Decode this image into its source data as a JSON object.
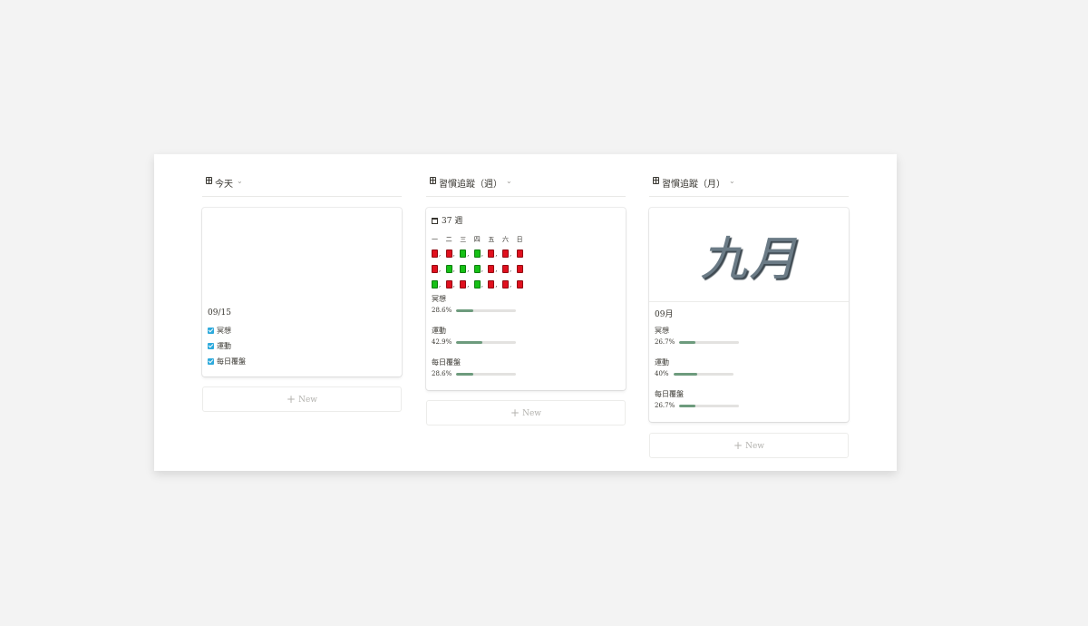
{
  "columns": [
    {
      "header": "今天",
      "card": {
        "date": "09/15",
        "checklist": [
          "冥想",
          "運動",
          "每日覆盤"
        ]
      },
      "new_label": "New"
    },
    {
      "header": "習慣追蹤（週）",
      "card": {
        "week_title": "37 週",
        "weekdays": [
          "一",
          "二",
          "三",
          "四",
          "五",
          "六",
          "日"
        ],
        "grid": [
          [
            "red",
            "red",
            "green",
            "green",
            "red",
            "red",
            "red"
          ],
          [
            "red",
            "green",
            "green",
            "green",
            "red",
            "red",
            "red"
          ],
          [
            "green",
            "red",
            "red",
            "green",
            "red",
            "red",
            "red"
          ]
        ],
        "stats": [
          {
            "label": "冥想",
            "percent_text": "28.6%",
            "value": 0.286
          },
          {
            "label": "運動",
            "percent_text": "42.9%",
            "value": 0.429
          },
          {
            "label": "每日覆盤",
            "percent_text": "28.6%",
            "value": 0.286
          }
        ]
      },
      "new_label": "New"
    },
    {
      "header": "習慣追蹤（月）",
      "card": {
        "cover_text": "九月",
        "month_title": "09月",
        "stats": [
          {
            "label": "冥想",
            "percent_text": "26.7%",
            "value": 0.267
          },
          {
            "label": "運動",
            "percent_text": "40%",
            "value": 0.4
          },
          {
            "label": "每日覆盤",
            "percent_text": "26.7%",
            "value": 0.267
          }
        ]
      },
      "new_label": "New"
    }
  ],
  "colors": {
    "checkbox": "#2eaadc",
    "bar_fill": "#6d9b7d",
    "bar_track": "#e3e2e0",
    "red": "#e0101e",
    "green": "#16c016"
  },
  "icons": {
    "view": "table-icon",
    "dropdown": "chevron-down-icon",
    "week": "calendar-icon",
    "add": "plus-icon"
  }
}
